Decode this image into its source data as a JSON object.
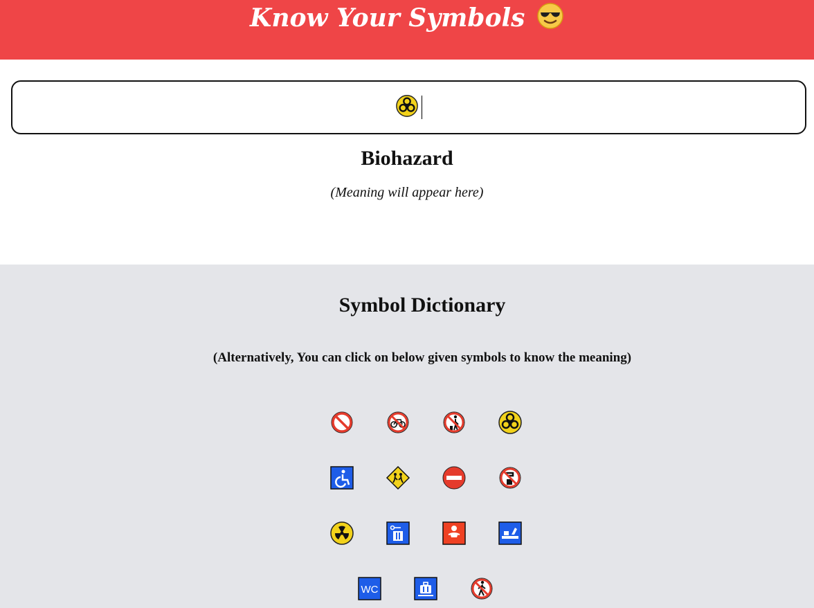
{
  "header": {
    "title": "Know Your Symbols",
    "title_emoji": "smiling-face-with-sunglasses-icon",
    "bg_color": "#ef4547"
  },
  "search": {
    "value": "☣",
    "value_icon": "biohazard-icon"
  },
  "result": {
    "name": "Biohazard",
    "meaning": "(Meaning will appear here)"
  },
  "dictionary": {
    "title": "Symbol Dictionary",
    "hint": "(Alternatively, You can click on below given symbols to know the meaning)",
    "bg_color": "#e4e5e9",
    "symbols": [
      {
        "icon": "prohibited-icon"
      },
      {
        "icon": "no-bicycles-icon"
      },
      {
        "icon": "no-littering-icon"
      },
      {
        "icon": "biohazard-icon"
      },
      {
        "icon": "wheelchair-icon"
      },
      {
        "icon": "children-crossing-icon"
      },
      {
        "icon": "no-entry-icon"
      },
      {
        "icon": "non-potable-water-icon"
      },
      {
        "icon": "radioactive-icon"
      },
      {
        "icon": "left-luggage-icon"
      },
      {
        "icon": "baby-symbol-icon"
      },
      {
        "icon": "customs-icon"
      },
      {
        "icon": "water-closet-icon",
        "text": "WC"
      },
      {
        "icon": "baggage-claim-icon"
      },
      {
        "icon": "no-pedestrians-icon"
      }
    ]
  }
}
